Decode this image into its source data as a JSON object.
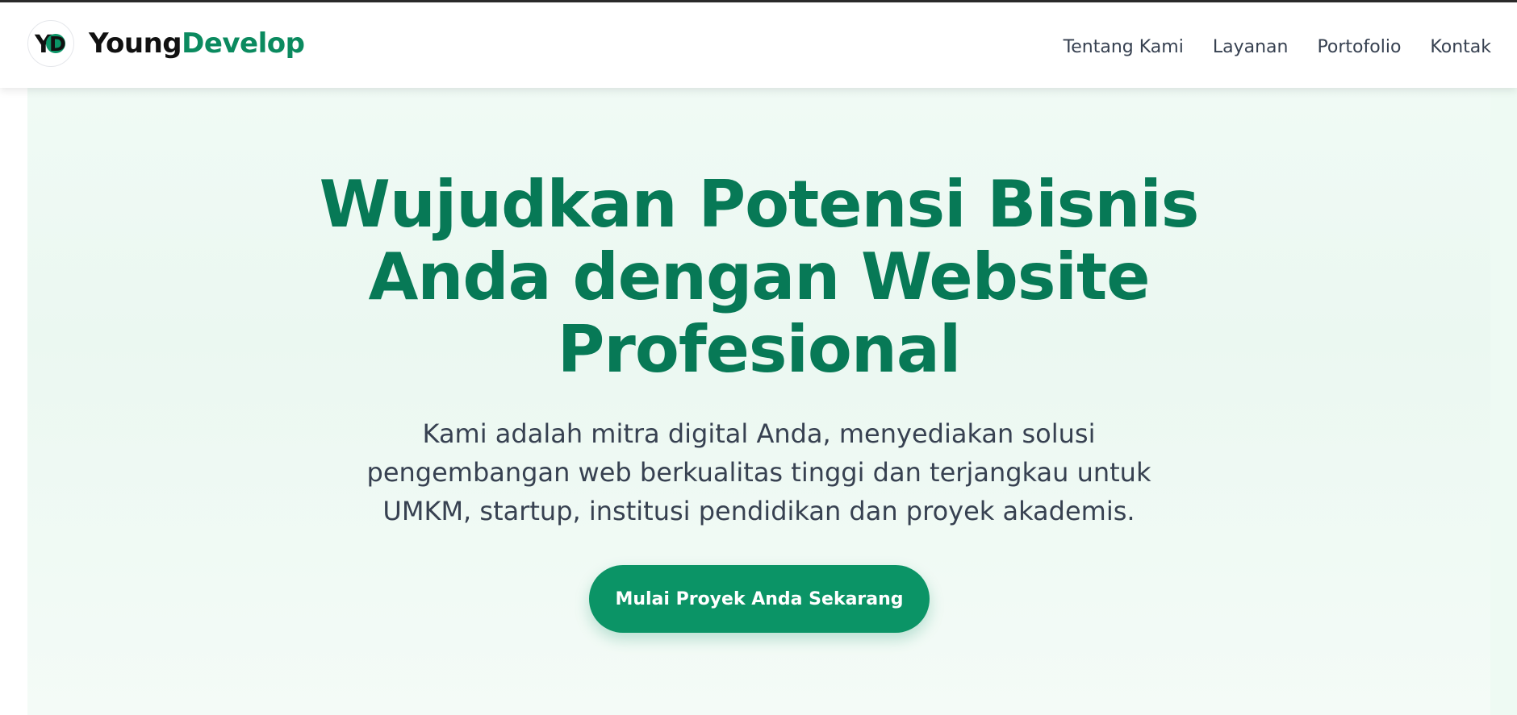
{
  "header": {
    "logo_icon": "yd-logo-icon",
    "logo_letters": "YD",
    "brand_part1": "Young",
    "brand_part2": "Develop",
    "nav": [
      {
        "label": "Tentang Kami"
      },
      {
        "label": "Layanan"
      },
      {
        "label": "Portofolio"
      },
      {
        "label": "Kontak"
      }
    ]
  },
  "hero": {
    "title_lines": [
      "Wujudkan Potensi Bisnis",
      "Anda dengan Website",
      "Profesional"
    ],
    "subtitle_lines": [
      "Kami adalah mitra digital Anda, menyediakan solusi",
      "pengembangan web berkualitas tinggi dan terjangkau untuk",
      "UMKM, startup, institusi pendidikan dan proyek akademis."
    ],
    "cta_label": "Mulai Proyek Anda Sekarang"
  },
  "colors": {
    "primary": "#077956",
    "accent": "#0b9466",
    "text": "#374151",
    "hero_bg": "#edf9f3"
  }
}
